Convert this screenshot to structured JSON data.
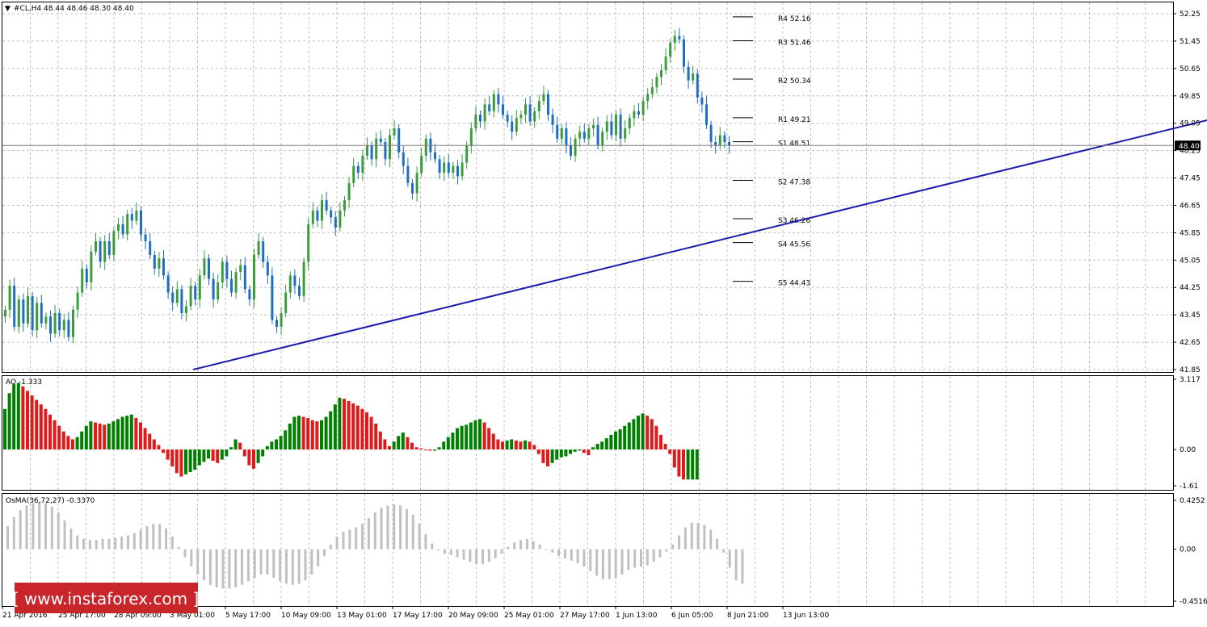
{
  "header": {
    "symbol_line": "#CL,H4  48.44 48.46 48.30 48.40",
    "ao_label": "AO -1.333",
    "osma_label": "OsMA(36,72,27) -0.3370"
  },
  "price_axis": {
    "ticks": [
      "52.25",
      "51.45",
      "50.65",
      "49.85",
      "49.05",
      "48.25",
      "47.45",
      "46.65",
      "45.85",
      "45.05",
      "44.25",
      "43.45",
      "42.65",
      "41.85"
    ],
    "current_price": "48.40"
  },
  "ao_axis": {
    "ticks": [
      "3.117",
      "0.00",
      "-1.61"
    ]
  },
  "osma_axis": {
    "ticks": [
      "0.4252",
      "0.00",
      "-0.4516"
    ]
  },
  "time_axis": {
    "labels": [
      "21 Apr 2016",
      "25 Apr 17:00",
      "28 Apr 09:00",
      "3 May 01:00",
      "5 May 17:00",
      "10 May 09:00",
      "13 May 01:00",
      "17 May 17:00",
      "20 May 09:00",
      "25 May 01:00",
      "27 May 17:00",
      "1 Jun 13:00",
      "6 Jun 05:00",
      "8 Jun 21:00",
      "13 Jun 13:00"
    ]
  },
  "pivot_levels": [
    {
      "name": "R4",
      "value": "52.16",
      "label": "R4 52.16"
    },
    {
      "name": "R3",
      "value": "51.46",
      "label": "R3 51.46"
    },
    {
      "name": "R2",
      "value": "50.34",
      "label": "R2 50.34"
    },
    {
      "name": "R1",
      "value": "49.21",
      "label": "R1 49.21"
    },
    {
      "name": "S1",
      "value": "48.51",
      "label": "S1 48.51"
    },
    {
      "name": "S2",
      "value": "47.38",
      "label": "S2 47.38"
    },
    {
      "name": "S3",
      "value": "46.26",
      "label": "S3 46.26"
    },
    {
      "name": "S4",
      "value": "45.56",
      "label": "S4 45.56"
    },
    {
      "name": "S5",
      "value": "44.43",
      "label": "S5 44.43"
    }
  ],
  "watermark": {
    "text": "[ www.instaforex.com ]"
  },
  "colors": {
    "bull": "#3c9c3c",
    "bear": "#1f6ec2",
    "trendline": "#1a1aad",
    "ao_up": "#008000",
    "ao_down": "#e01a1a",
    "osma": "#c0c0c0",
    "grid": "#c0c0c0",
    "price_tag_bg": "#000000",
    "watermark_bg": "#c8262b"
  },
  "chart_data": [
    {
      "type": "candlestick",
      "title": "#CL,H4",
      "ylim": [
        41.85,
        52.25
      ],
      "trendline": {
        "from": [
          42,
          41.85
        ],
        "to": [
          288,
          49.85
        ]
      },
      "close": [
        43.6,
        44.3,
        43.1,
        43.9,
        43.2,
        44.0,
        43.0,
        43.8,
        43.2,
        43.4,
        42.9,
        43.5,
        43.0,
        43.3,
        42.8,
        43.6,
        44.1,
        44.8,
        44.4,
        45.3,
        45.6,
        45.0,
        45.6,
        45.2,
        45.9,
        46.1,
        45.8,
        46.4,
        46.2,
        46.5,
        45.8,
        45.6,
        45.2,
        44.8,
        45.1,
        44.6,
        44.1,
        43.8,
        44.2,
        43.5,
        43.7,
        44.3,
        43.9,
        44.6,
        45.1,
        44.5,
        43.9,
        44.4,
        45.0,
        44.5,
        44.1,
        44.7,
        44.9,
        44.2,
        43.9,
        45.2,
        45.6,
        45.0,
        44.6,
        43.3,
        43.1,
        43.5,
        44.1,
        44.6,
        44.3,
        44.0,
        45.0,
        46.1,
        46.5,
        46.2,
        46.8,
        46.5,
        46.3,
        46.0,
        46.5,
        46.8,
        47.3,
        47.8,
        47.6,
        48.1,
        48.4,
        48.0,
        48.6,
        48.5,
        48.0,
        48.7,
        48.9,
        48.2,
        47.8,
        47.3,
        47.0,
        47.6,
        48.1,
        48.6,
        48.2,
        48.0,
        47.6,
        47.9,
        47.6,
        47.8,
        47.5,
        47.9,
        48.4,
        48.9,
        49.3,
        49.1,
        49.6,
        49.4,
        49.9,
        49.6,
        49.3,
        49.1,
        48.8,
        49.2,
        49.3,
        49.6,
        49.1,
        49.4,
        49.7,
        49.9,
        49.3,
        49.0,
        48.6,
        48.9,
        48.4,
        48.1,
        48.6,
        48.8,
        48.6,
        48.9,
        49.0,
        48.4,
        48.8,
        49.1,
        48.7,
        49.3,
        48.6,
        48.9,
        49.2,
        49.4,
        49.3,
        49.7,
        49.9,
        50.1,
        50.4,
        50.6,
        51.0,
        51.4,
        51.6,
        51.5,
        50.7,
        50.3,
        50.5,
        49.8,
        49.6,
        49.0,
        48.5,
        48.4,
        48.7,
        48.5,
        48.4
      ]
    },
    {
      "type": "bar",
      "title": "AO",
      "ylim": [
        -1.61,
        3.117
      ],
      "values": [
        1.8,
        2.5,
        2.9,
        2.95,
        2.8,
        2.6,
        2.4,
        2.2,
        2.0,
        1.8,
        1.55,
        1.3,
        1.05,
        0.8,
        0.6,
        0.45,
        0.55,
        0.8,
        1.05,
        1.25,
        1.2,
        1.15,
        1.1,
        1.15,
        1.25,
        1.35,
        1.45,
        1.5,
        1.55,
        1.4,
        1.2,
        0.95,
        0.7,
        0.45,
        0.2,
        -0.15,
        -0.45,
        -0.75,
        -1.05,
        -1.2,
        -1.1,
        -1.0,
        -0.9,
        -0.7,
        -0.55,
        -0.4,
        -0.5,
        -0.6,
        -0.45,
        -0.3,
        0.1,
        0.45,
        0.3,
        -0.3,
        -0.7,
        -0.85,
        -0.6,
        -0.3,
        0.15,
        0.35,
        0.45,
        0.6,
        0.85,
        1.15,
        1.45,
        1.5,
        1.45,
        1.4,
        1.3,
        1.25,
        1.3,
        1.45,
        1.7,
        2.0,
        2.3,
        2.25,
        2.15,
        2.05,
        1.95,
        1.8,
        1.65,
        1.45,
        1.15,
        0.8,
        0.45,
        0.15,
        0.35,
        0.6,
        0.75,
        0.55,
        0.3,
        0.1,
        0.05,
        0.0,
        -0.05,
        -0.05,
        0.1,
        0.35,
        0.55,
        0.75,
        0.95,
        1.05,
        1.1,
        1.2,
        1.3,
        1.35,
        1.2,
        0.95,
        0.7,
        0.45,
        0.35,
        0.4,
        0.45,
        0.4,
        0.35,
        0.4,
        0.35,
        0.2,
        -0.2,
        -0.6,
        -0.75,
        -0.6,
        -0.45,
        -0.35,
        -0.3,
        -0.2,
        -0.1,
        -0.05,
        -0.15,
        -0.25,
        0.1,
        0.25,
        0.35,
        0.5,
        0.65,
        0.8,
        0.9,
        1.05,
        1.2,
        1.35,
        1.5,
        1.6,
        1.5,
        1.35,
        1.05,
        0.65,
        0.25,
        -0.2,
        -0.8,
        -1.2,
        -1.333,
        -1.333,
        -1.333,
        -1.333
      ]
    },
    {
      "type": "bar",
      "title": "OsMA(36,72,27)",
      "ylim": [
        -0.4516,
        0.4252
      ],
      "values": [
        0.2,
        0.28,
        0.34,
        0.38,
        0.4,
        0.41,
        0.4,
        0.37,
        0.32,
        0.25,
        0.18,
        0.12,
        0.09,
        0.08,
        0.08,
        0.09,
        0.09,
        0.1,
        0.11,
        0.12,
        0.14,
        0.17,
        0.2,
        0.22,
        0.22,
        0.18,
        0.11,
        0.02,
        -0.07,
        -0.15,
        -0.22,
        -0.27,
        -0.31,
        -0.33,
        -0.34,
        -0.34,
        -0.33,
        -0.31,
        -0.28,
        -0.25,
        -0.22,
        -0.22,
        -0.25,
        -0.28,
        -0.3,
        -0.31,
        -0.3,
        -0.27,
        -0.22,
        -0.15,
        -0.06,
        0.04,
        0.11,
        0.15,
        0.17,
        0.19,
        0.22,
        0.27,
        0.32,
        0.36,
        0.38,
        0.39,
        0.38,
        0.35,
        0.3,
        0.22,
        0.13,
        0.05,
        -0.01,
        -0.04,
        -0.05,
        -0.07,
        -0.09,
        -0.11,
        -0.13,
        -0.13,
        -0.11,
        -0.08,
        -0.04,
        0.02,
        0.06,
        0.08,
        0.09,
        0.07,
        0.04,
        0.0,
        -0.03,
        -0.06,
        -0.08,
        -0.1,
        -0.12,
        -0.15,
        -0.19,
        -0.23,
        -0.26,
        -0.26,
        -0.25,
        -0.22,
        -0.18,
        -0.16,
        -0.15,
        -0.14,
        -0.11,
        -0.07,
        -0.02,
        0.04,
        0.12,
        0.19,
        0.23,
        0.23,
        0.21,
        0.17,
        0.09,
        -0.03,
        -0.16,
        -0.27,
        -0.3
      ]
    }
  ]
}
